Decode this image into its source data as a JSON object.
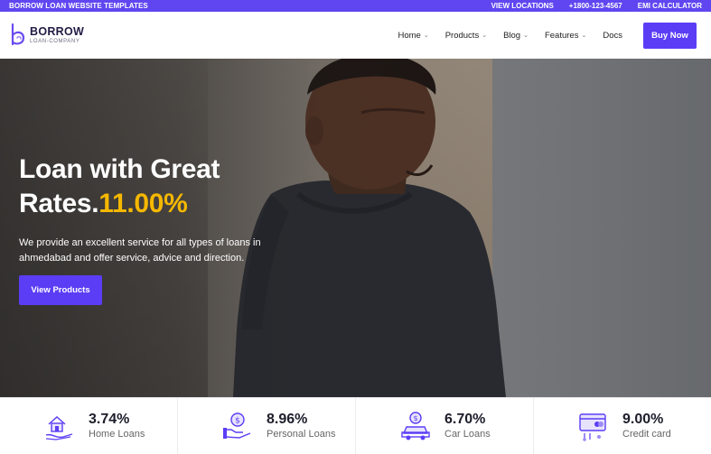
{
  "topbar": {
    "brand": "BORROW LOAN WEBSITE TEMPLATES",
    "locations": "VIEW LOCATIONS",
    "phone": "+1800-123-4567",
    "emi": "EMI CALCULATOR"
  },
  "logo": {
    "title": "BORROW",
    "subtitle": "LOAN-COMPANY"
  },
  "nav": {
    "items": [
      {
        "label": "Home",
        "has_dropdown": true
      },
      {
        "label": "Products",
        "has_dropdown": true
      },
      {
        "label": "Blog",
        "has_dropdown": true
      },
      {
        "label": "Features",
        "has_dropdown": true
      },
      {
        "label": "Docs",
        "has_dropdown": false
      }
    ],
    "cta": "Buy Now"
  },
  "hero": {
    "title_line1": "Loan with Great",
    "title_line2": "Rates.",
    "rate": "11.00%",
    "description": "We provide an excellent service for all types of loans in ahmedabad and offer service, advice and direction.",
    "button": "View Products"
  },
  "stats": [
    {
      "value": "3.74%",
      "label": "Home Loans",
      "icon": "home-loan-icon"
    },
    {
      "value": "8.96%",
      "label": "Personal Loans",
      "icon": "personal-loan-icon"
    },
    {
      "value": "6.70%",
      "label": "Car Loans",
      "icon": "car-loan-icon"
    },
    {
      "value": "9.00%",
      "label": "Credit card",
      "icon": "credit-card-icon"
    }
  ],
  "colors": {
    "accent": "#5b3df5",
    "topbar": "#6046f0",
    "highlight": "#f5b800"
  }
}
